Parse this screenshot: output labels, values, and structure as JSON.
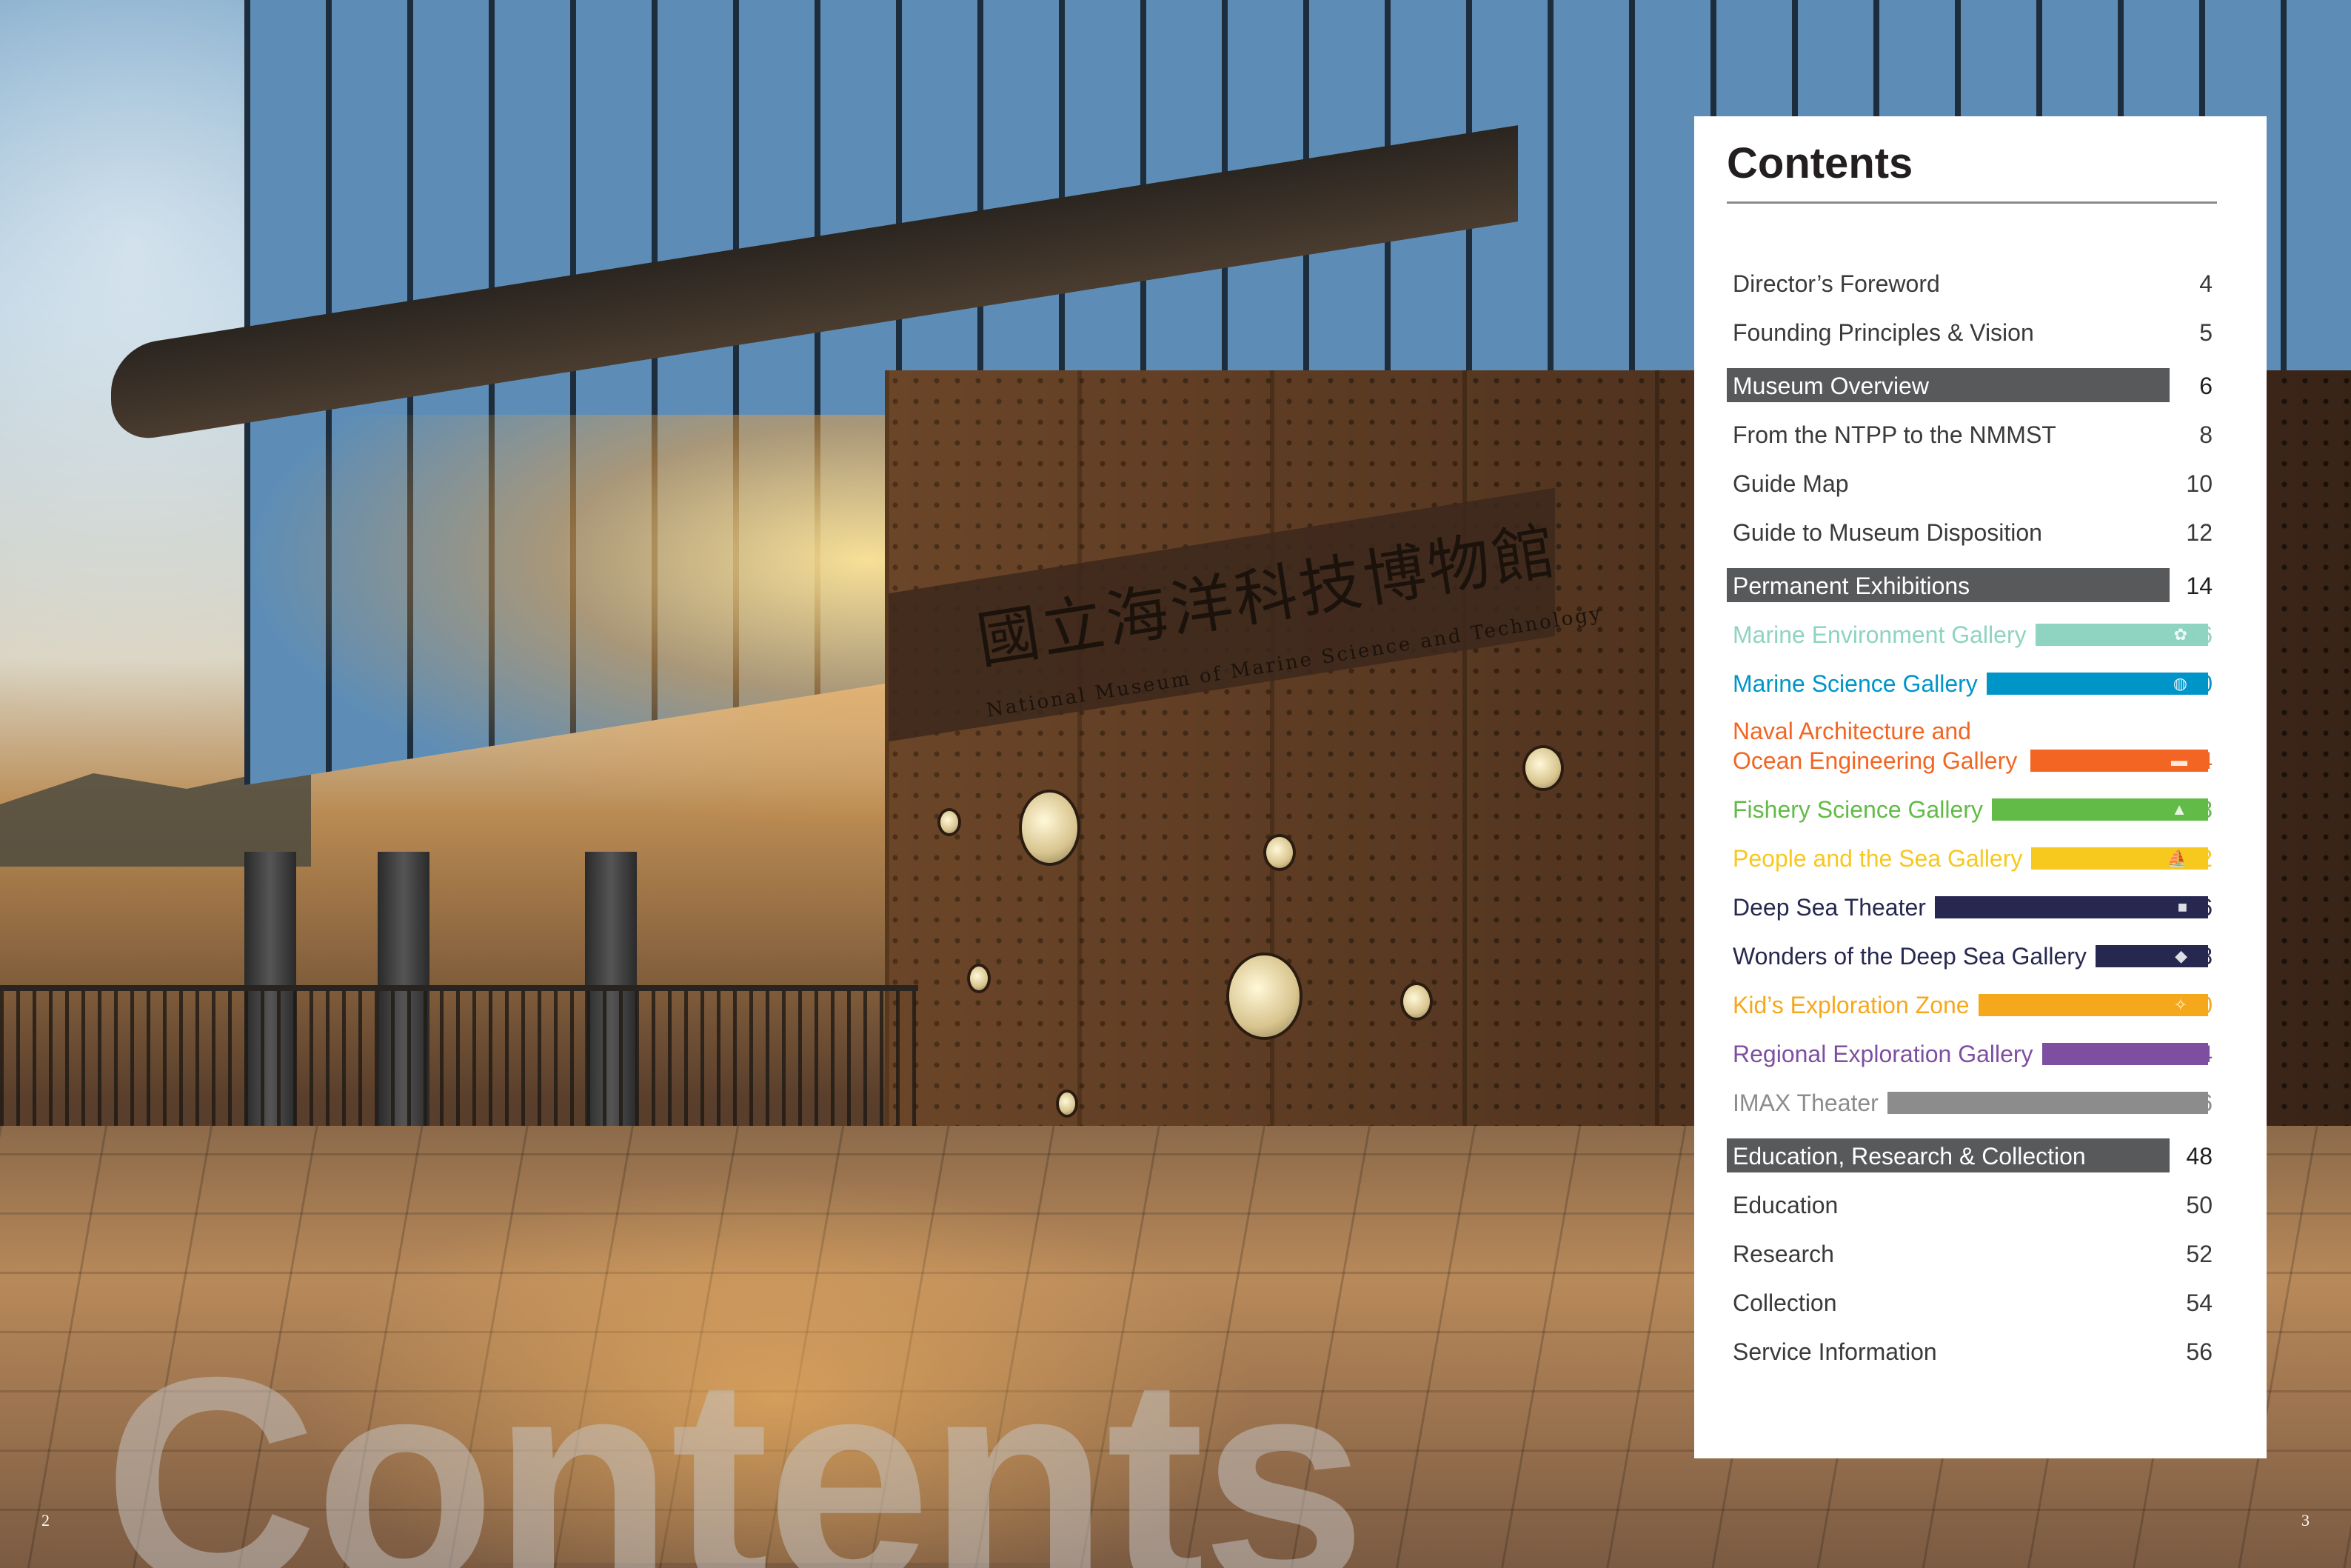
{
  "photo": {
    "sign_chinese": "國立海洋科技博物館",
    "sign_english": "National Museum of Marine Science and Technology",
    "background_word": "Contents"
  },
  "page_numbers": {
    "left": "2",
    "right": "3"
  },
  "contents": {
    "title": "Contents",
    "items": [
      {
        "label": "Director’s Foreword",
        "page": "4",
        "kind": "plain"
      },
      {
        "label": "Founding Principles & Vision",
        "page": "5",
        "kind": "plain"
      },
      {
        "label": "Museum Overview",
        "page": "6",
        "kind": "section"
      },
      {
        "label": "From the NTPP to the NMMST",
        "page": "8",
        "kind": "plain"
      },
      {
        "label": "Guide Map",
        "page": "10",
        "kind": "plain"
      },
      {
        "label": "Guide to Museum Disposition",
        "page": "12",
        "kind": "plain"
      },
      {
        "label": "Permanent Exhibitions",
        "page": "14",
        "kind": "section"
      },
      {
        "label": "Marine Environment Gallery",
        "page": "16",
        "kind": "gallery",
        "color": "#8fd3c1",
        "icon": "coral-icon"
      },
      {
        "label": "Marine Science Gallery",
        "page": "20",
        "kind": "gallery",
        "color": "#0095c8",
        "icon": "globe-icon"
      },
      {
        "label": "Naval Architecture and Ocean Engineering Gallery",
        "page": "24",
        "kind": "gallery",
        "color": "#f26522",
        "icon": "ship-icon",
        "tall": true
      },
      {
        "label": "Fishery Science Gallery",
        "page": "28",
        "kind": "gallery",
        "color": "#62bb46",
        "icon": "fishing-boat-icon"
      },
      {
        "label": "People and the Sea Gallery",
        "page": "32",
        "kind": "gallery",
        "color": "#f7c81e",
        "icon": "sailboat-icon"
      },
      {
        "label": "Deep Sea Theater",
        "page": "36",
        "kind": "gallery",
        "color": "#272850",
        "text_color": "#272850",
        "icon": "camera-icon"
      },
      {
        "label": "Wonders of the Deep Sea Gallery",
        "page": "38",
        "kind": "gallery",
        "color": "#272850",
        "text_color": "#272850",
        "icon": "submarine-icon"
      },
      {
        "label": "Kid’s Exploration Zone",
        "page": "40",
        "kind": "gallery",
        "color": "#f6a81d",
        "icon": "kid-icon"
      },
      {
        "label": "Regional Exploration Gallery",
        "page": "44",
        "kind": "gallery",
        "color": "#7e4fa0",
        "icon": ""
      },
      {
        "label": "IMAX Theater",
        "page": "46",
        "kind": "gallery",
        "color": "#8c8c8c",
        "icon": ""
      },
      {
        "label": "Education, Research & Collection",
        "page": "48",
        "kind": "section"
      },
      {
        "label": "Education",
        "page": "50",
        "kind": "plain"
      },
      {
        "label": "Research",
        "page": "52",
        "kind": "plain"
      },
      {
        "label": "Collection",
        "page": "54",
        "kind": "plain"
      },
      {
        "label": "Service Information",
        "page": "56",
        "kind": "plain"
      }
    ]
  }
}
